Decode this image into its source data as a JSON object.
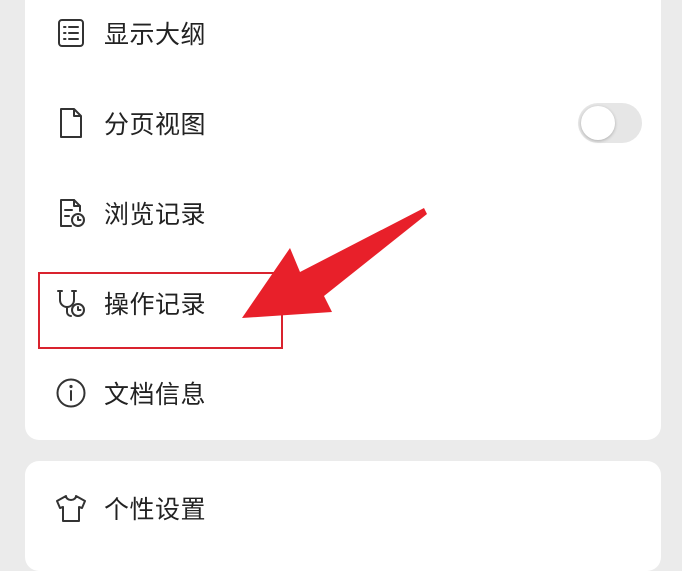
{
  "menu": {
    "items": [
      {
        "label": "显示大纲",
        "icon": "outline-list-icon"
      },
      {
        "label": "分页视图",
        "icon": "document-page-icon",
        "toggle": false
      },
      {
        "label": "浏览记录",
        "icon": "browse-history-icon"
      },
      {
        "label": "操作记录",
        "icon": "operation-history-icon"
      },
      {
        "label": "文档信息",
        "icon": "info-icon"
      }
    ],
    "settings": {
      "label": "个性设置",
      "icon": "tshirt-icon"
    }
  },
  "colors": {
    "background": "#ebebeb",
    "card": "#ffffff",
    "text": "#222222",
    "highlight": "#d9232e",
    "arrow": "#e8202a",
    "toggle_off": "#e6e6e6"
  }
}
